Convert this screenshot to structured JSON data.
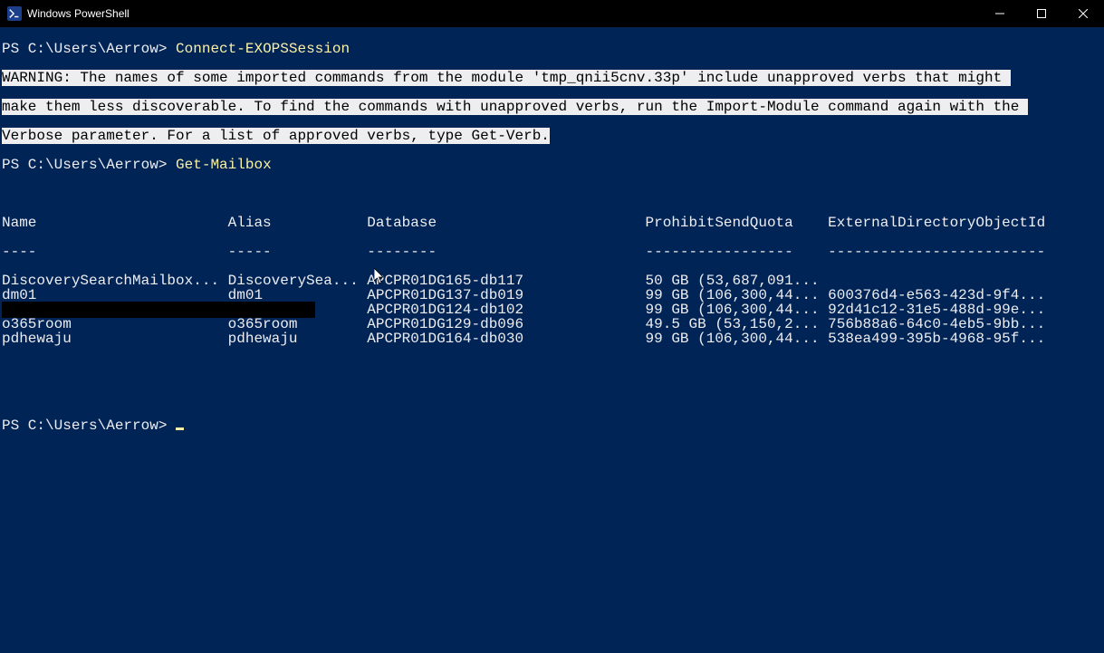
{
  "window": {
    "title": "Windows PowerShell"
  },
  "session": {
    "prompt": "PS C:\\Users\\Aerrow>",
    "commands": {
      "connect": "Connect-EXOPSSession",
      "getmailbox": "Get-Mailbox"
    },
    "warning": "WARNING: The names of some imported commands from the module 'tmp_qnii5cnv.33p' include unapproved verbs that might make them less discoverable. To find the commands with unapproved verbs, run the Import-Module command again with the Verbose parameter. For a list of approved verbs, type Get-Verb.",
    "warning_lines": {
      "l1": "WARNING: The names of some imported commands from the module 'tmp_qnii5cnv.33p' include unapproved verbs that might ",
      "l2": "make them less discoverable. To find the commands with unapproved verbs, run the Import-Module command again with the ",
      "l3": "Verbose parameter. For a list of approved verbs, type Get-Verb."
    }
  },
  "table": {
    "columns": {
      "name": "Name",
      "alias": "Alias",
      "database": "Database",
      "prohibit": "ProhibitSendQuota",
      "extdir": "ExternalDirectoryObjectId"
    },
    "dividers": {
      "name": "----",
      "alias": "-----",
      "database": "--------",
      "prohibit": "-----------------",
      "extdir": "-------------------------"
    },
    "rows": [
      {
        "name": "DiscoverySearchMailbox...",
        "alias": "DiscoverySea...",
        "database": "APCPR01DG165-db117",
        "prohibit": "50 GB (53,687,091...",
        "extdir": ""
      },
      {
        "name": "dm01",
        "alias": "dm01",
        "database": "APCPR01DG137-db019",
        "prohibit": "99 GB (106,300,44...",
        "extdir": "600376d4-e563-423d-9f4..."
      },
      {
        "name": "",
        "alias": "",
        "database": "APCPR01DG124-db102",
        "prohibit": "99 GB (106,300,44...",
        "extdir": "92d41c12-31e5-488d-99e..."
      },
      {
        "name": "o365room",
        "alias": "o365room",
        "database": "APCPR01DG129-db096",
        "prohibit": "49.5 GB (53,150,2...",
        "extdir": "756b88a6-64c0-4eb5-9bb..."
      },
      {
        "name": "pdhewaju",
        "alias": "pdhewaju",
        "database": "APCPR01DG164-db030",
        "prohibit": "99 GB (106,300,44...",
        "extdir": "538ea499-395b-4968-95f..."
      }
    ]
  }
}
